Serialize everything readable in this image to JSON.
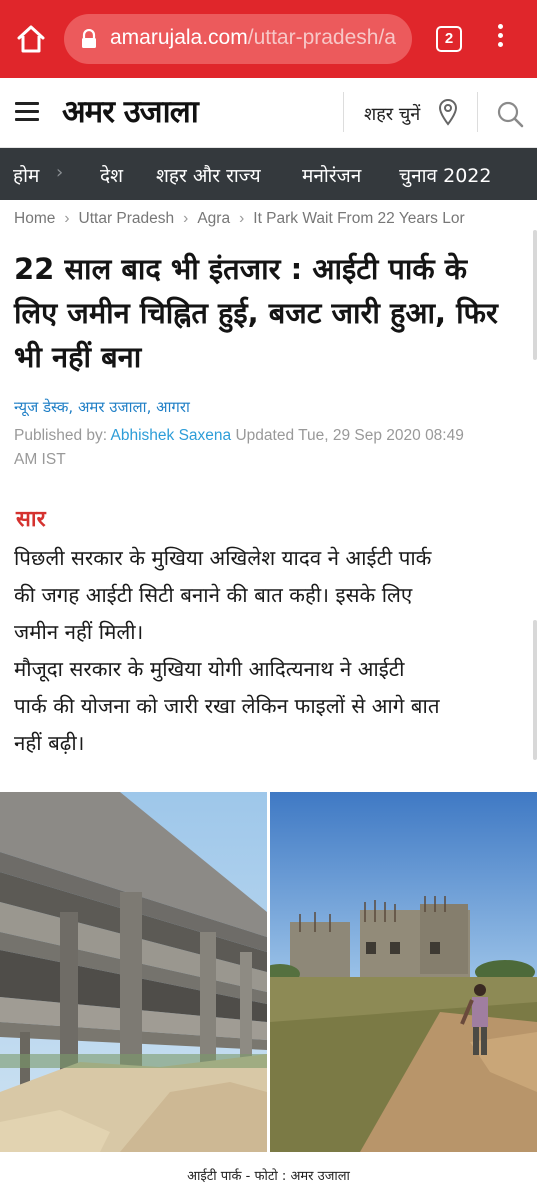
{
  "browser": {
    "url_domain": "amarujala.com",
    "url_path": "/uttar-pradesh/a",
    "tab_count": "2",
    "icons": [
      "home-icon",
      "lock-icon",
      "tabs-icon",
      "more-vert-icon"
    ],
    "accent_color": "#e0262b"
  },
  "header": {
    "logo": "अमर उजाला",
    "city_select": "शहर चुनें",
    "icons": [
      "menu-icon",
      "location-pin-icon",
      "search-icon"
    ]
  },
  "nav": {
    "items": [
      "होम",
      "देश",
      "शहर और राज्य",
      "मनोरंजन",
      "चुनाव 2022"
    ],
    "background_color": "#34393d"
  },
  "breadcrumb": [
    "Home",
    "Uttar Pradesh",
    "Agra",
    "It Park Wait From 22 Years Lor"
  ],
  "article": {
    "title_lines": [
      "22 साल बाद भी इंतजार : आईटी पार्क के",
      "लिए जमीन चिह्नित हुई, बजट जारी हुआ, फिर",
      "भी नहीं बना"
    ],
    "byline": "न्यूज डेस्क, अमर उजाला, आगरा",
    "published_prefix": "Published by:",
    "author": "Abhishek Saxena",
    "updated_line1": "Updated Tue, 29 Sep 2020 08:49",
    "updated_line2": "AM IST",
    "summary_label": "सार",
    "summary_lines": [
      "पिछली सरकार के मुखिया अखिलेश यादव ने आईटी पार्क",
      "की जगह आईटी सिटी बनाने की बात कही। इसके लिए",
      "जमीन नहीं मिली।",
      "मौजूदा सरकार के मुखिया योगी आदित्यनाथ ने आईटी",
      "पार्क की योजना को जारी रखा लेकिन फाइलों से आगे बात",
      "नहीं बढ़ी।"
    ],
    "photo_caption": "आईटी पार्क  - फोटो : अमर उजाला"
  }
}
